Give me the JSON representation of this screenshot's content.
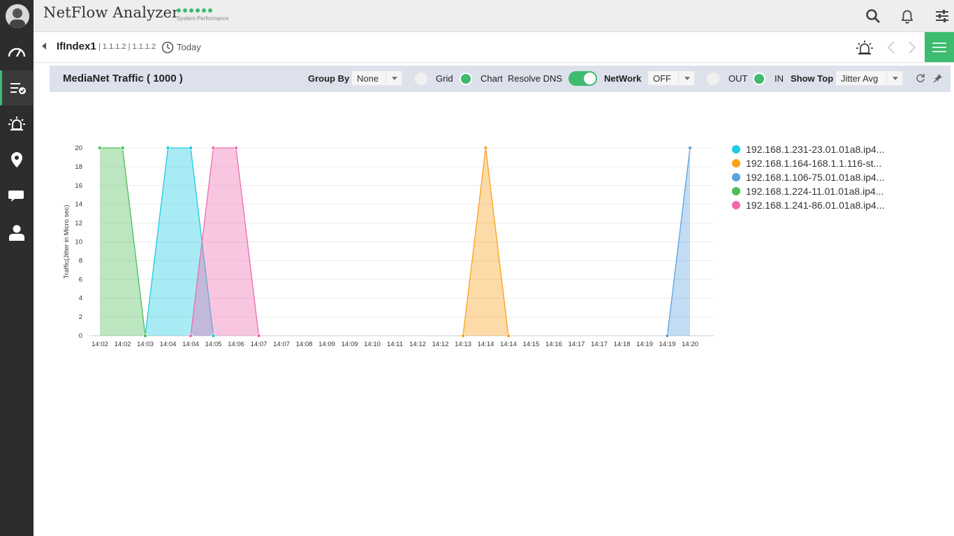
{
  "app": {
    "title": "NetFlow Analyzer",
    "status_label": "System Performance"
  },
  "subheader": {
    "interface_name": "IfIndex1",
    "interface_ips": "| 1.1.1.2 | 1.1.1.2",
    "period": "Today"
  },
  "widget": {
    "title": "MediaNet Traffic ( 1000 )",
    "group_by_label": "Group By",
    "group_by_value": "None",
    "grid_label": "Grid",
    "chart_label": "Chart",
    "resolve_dns_label": "Resolve DNS",
    "network_label": "NetWork",
    "network_value": "OFF",
    "out_label": "OUT",
    "in_label": "IN",
    "show_top_label": "Show Top",
    "show_top_value": "Jitter Avg"
  },
  "colors": {
    "accent": "#3dbb6f",
    "sidebar": "#2d2d2d"
  },
  "chart_data": {
    "type": "area",
    "ylabel": "Traffic(Jitter in Micro sec)",
    "ylim": [
      0,
      20
    ],
    "yticks": [
      0,
      2,
      4,
      6,
      8,
      10,
      12,
      14,
      16,
      18,
      20
    ],
    "x": [
      "14:02",
      "14:02",
      "14:03",
      "14:04",
      "14:04",
      "14:05",
      "14:06",
      "14:07",
      "14:07",
      "14:08",
      "14:09",
      "14:09",
      "14:10",
      "14:11",
      "14:12",
      "14:12",
      "14:13",
      "14:14",
      "14:14",
      "14:15",
      "14:16",
      "14:17",
      "14:17",
      "14:18",
      "14:19",
      "14:19",
      "14:20"
    ],
    "legend_position": "right",
    "series": [
      {
        "name": "192.168.1.231-23.01.01a8.ip4...",
        "color": "#1ecbe1",
        "values": [
          0,
          0,
          0,
          20,
          20,
          0,
          0,
          0,
          0,
          0,
          0,
          0,
          0,
          0,
          0,
          0,
          0,
          0,
          0,
          0,
          0,
          0,
          0,
          0,
          0,
          0,
          0
        ]
      },
      {
        "name": "192.168.1.164-168.1.1.116-st...",
        "color": "#f9a11b",
        "values": [
          0,
          0,
          0,
          0,
          0,
          0,
          0,
          0,
          0,
          0,
          0,
          0,
          0,
          0,
          0,
          0,
          0,
          20,
          0,
          0,
          0,
          0,
          0,
          0,
          0,
          0,
          0
        ]
      },
      {
        "name": "192.168.1.106-75.01.01a8.ip4...",
        "color": "#5ba3e0",
        "values": [
          0,
          0,
          0,
          0,
          0,
          0,
          0,
          0,
          0,
          0,
          0,
          0,
          0,
          0,
          0,
          0,
          0,
          0,
          0,
          0,
          0,
          0,
          0,
          0,
          0,
          0,
          20
        ]
      },
      {
        "name": "192.168.1.224-11.01.01a8.ip4...",
        "color": "#4dbd5a",
        "values": [
          20,
          20,
          0,
          0,
          0,
          0,
          0,
          0,
          0,
          0,
          0,
          0,
          0,
          0,
          0,
          0,
          0,
          0,
          0,
          0,
          0,
          0,
          0,
          0,
          0,
          0,
          0
        ]
      },
      {
        "name": "192.168.1.241-86.01.01a8.ip4...",
        "color": "#f06ab0",
        "values": [
          0,
          0,
          0,
          0,
          0,
          20,
          20,
          0,
          0,
          0,
          0,
          0,
          0,
          0,
          0,
          0,
          0,
          0,
          0,
          0,
          0,
          0,
          0,
          0,
          0,
          0,
          0
        ]
      }
    ]
  }
}
